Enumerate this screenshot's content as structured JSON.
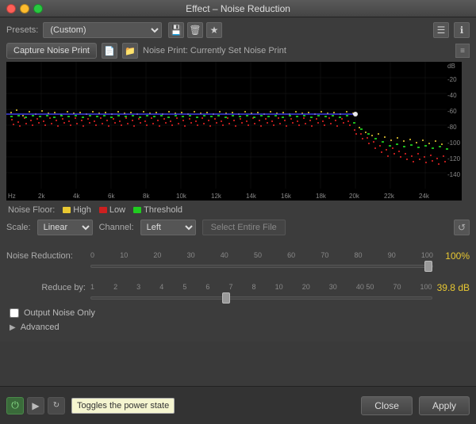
{
  "window": {
    "title": "Effect – Noise Reduction",
    "close_label": "×",
    "minimize_label": "–",
    "maximize_label": "+"
  },
  "presets": {
    "label": "Presets:",
    "current_value": "(Custom)",
    "save_icon": "💾",
    "delete_icon": "🗑",
    "favorite_icon": "★",
    "menu_icon": "☰",
    "info_icon": "ℹ"
  },
  "noise_print": {
    "capture_label": "Capture Noise Print",
    "file_icon": "📄",
    "folder_icon": "📁",
    "text": "Noise Print: Currently Set Noise Print",
    "collapse_icon": "≡"
  },
  "legend": {
    "items": [
      {
        "label": "Noise Floor:",
        "items": []
      },
      {
        "color": "yellow",
        "label": "High"
      },
      {
        "color": "red",
        "label": "Low"
      },
      {
        "color": "green",
        "label": "Threshold"
      }
    ]
  },
  "scale_row": {
    "scale_label": "Scale:",
    "scale_value": "Linear",
    "channel_label": "Channel:",
    "channel_value": "Left",
    "select_entire_label": "Select Entire File",
    "reset_icon": "↺"
  },
  "noise_reduction": {
    "label": "Noise Reduction:",
    "min": 0,
    "max": 100,
    "value": 100,
    "unit": "%",
    "ticks": [
      "0",
      "10",
      "20",
      "30",
      "40",
      "50",
      "60",
      "70",
      "80",
      "90",
      "100"
    ],
    "display_value": "100%"
  },
  "reduce_by": {
    "label": "Reduce by:",
    "min": 1,
    "max": 100,
    "value": 39.8,
    "unit": "dB",
    "ticks": [
      "1",
      "2",
      "3",
      "4",
      "5",
      "6",
      "7",
      "8",
      "10",
      "20",
      "30",
      "40 50",
      "70",
      "100"
    ],
    "display_value": "39.8 dB"
  },
  "output_noise_only": {
    "label": "Output Noise Only",
    "checked": false
  },
  "advanced": {
    "label": "Advanced"
  },
  "bottom_bar": {
    "power_icon": "⏻",
    "play_icon": "▶",
    "loop_icon": "🔁",
    "tooltip": "Toggles the power state",
    "close_label": "Close",
    "apply_label": "Apply"
  },
  "spectrum": {
    "db_labels": [
      "dB",
      "-20",
      "-40",
      "-60",
      "-80",
      "-100",
      "-120",
      "-140"
    ],
    "freq_labels": [
      "Hz",
      "2k",
      "4k",
      "6k",
      "8k",
      "10k",
      "12k",
      "14k",
      "16k",
      "18k",
      "20k",
      "22k",
      "24k"
    ]
  }
}
